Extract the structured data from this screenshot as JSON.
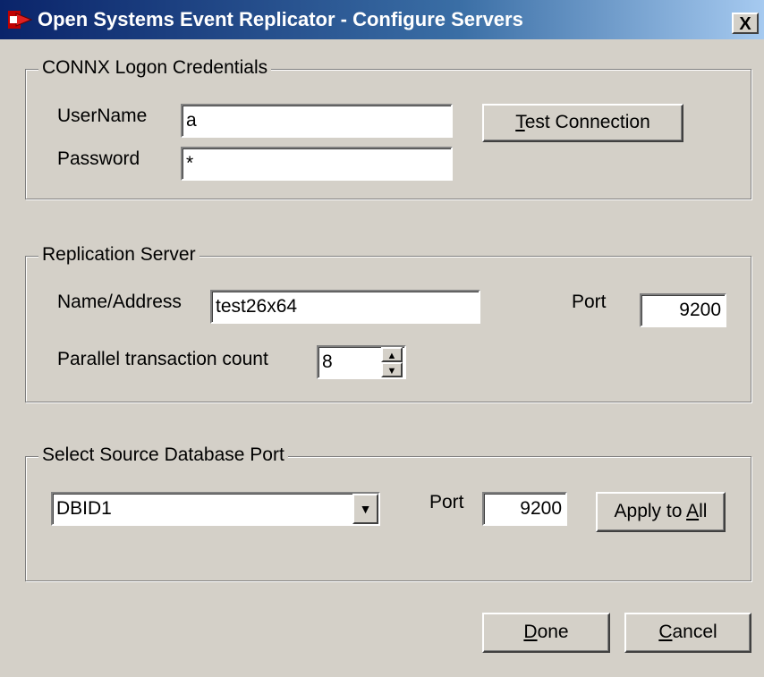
{
  "window": {
    "title": "Open Systems Event Replicator - Configure Servers",
    "close_glyph": "X",
    "app_icon": "replicator-app-icon"
  },
  "credentials": {
    "group_label": "CONNX Logon Credentials",
    "username_label": "UserName",
    "username_value": "a",
    "password_label": "Password",
    "password_value": "*",
    "test_button_pre": "",
    "test_button_accel": "T",
    "test_button_post": "est Connection"
  },
  "replication": {
    "group_label": "Replication Server",
    "name_label": "Name/Address",
    "name_value": "test26x64",
    "port_label": "Port",
    "port_value": "9200",
    "parallel_label": "Parallel transaction count",
    "parallel_value": "8"
  },
  "source": {
    "group_label": "Select Source Database Port",
    "db_selected": "DBID1",
    "port_label": "Port",
    "port_value": "9200",
    "apply_pre": "Apply to ",
    "apply_accel": "A",
    "apply_post": "ll"
  },
  "footer": {
    "done_accel": "D",
    "done_post": "one",
    "cancel_accel": "C",
    "cancel_post": "ancel"
  }
}
